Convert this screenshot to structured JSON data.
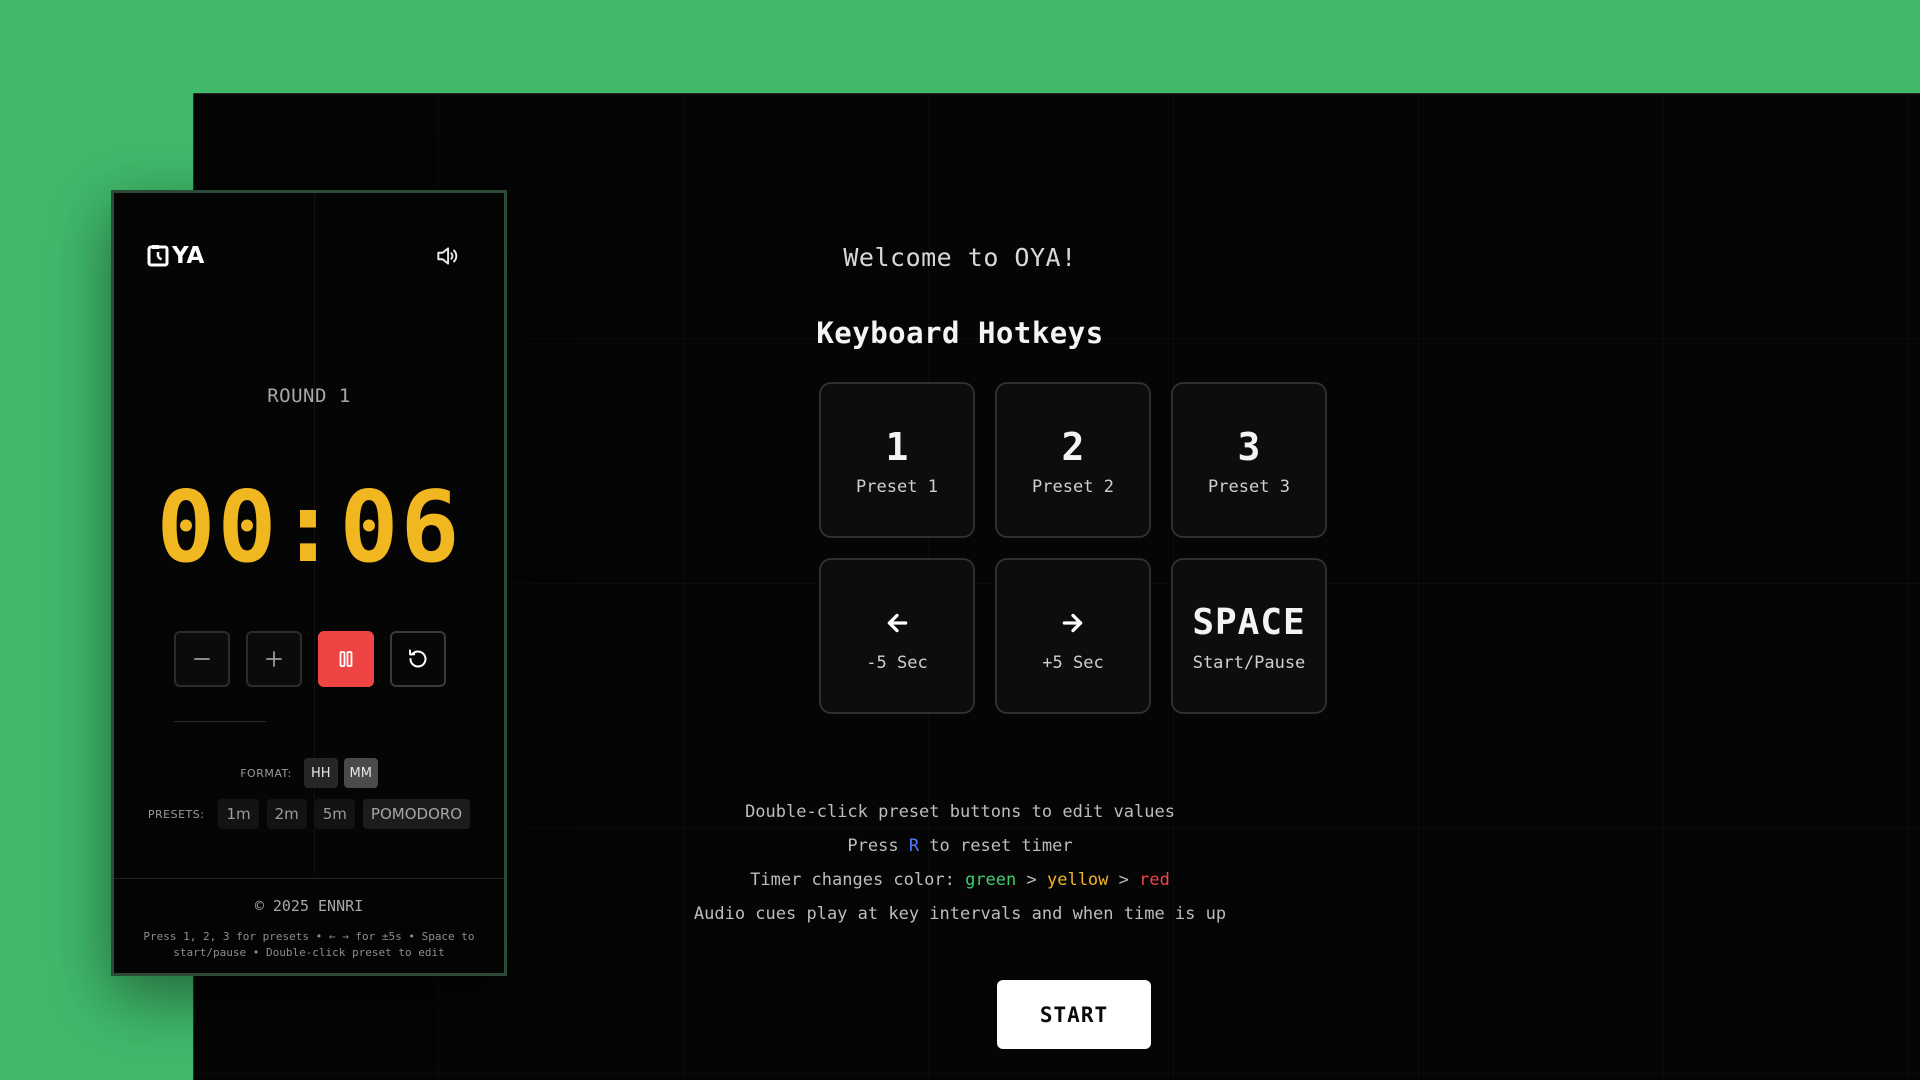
{
  "app": {
    "logo_text": "YA"
  },
  "main": {
    "welcome": "Welcome to OYA!",
    "hotkeys_title": "Keyboard Hotkeys",
    "hotkeys": [
      {
        "key": "1",
        "label": "Preset 1"
      },
      {
        "key": "2",
        "label": "Preset 2"
      },
      {
        "key": "3",
        "label": "Preset 3"
      },
      {
        "key": "arrow-left-icon",
        "label": "-5 Sec"
      },
      {
        "key": "arrow-right-icon",
        "label": "+5 Sec"
      },
      {
        "key": "SPACE",
        "label": "Start/Pause"
      }
    ],
    "tips": {
      "line1": "Double-click preset buttons to edit values",
      "line2_pre": "Press ",
      "line2_key": "R",
      "line2_post": " to reset timer",
      "line3_pre": "Timer changes color: ",
      "line3_green": "green",
      "line3_sep1": " > ",
      "line3_yellow": "yellow",
      "line3_sep2": " > ",
      "line3_red": "red",
      "line4": "Audio cues play at key intervals and when time is up"
    },
    "start_label": "START"
  },
  "widget": {
    "round": "ROUND 1",
    "time": "00:06",
    "format_label": "FORMAT:",
    "format_options": [
      "HH",
      "MM"
    ],
    "format_selected": "MM",
    "presets_label": "PRESETS:",
    "presets": [
      "1m",
      "2m",
      "5m",
      "POMODORO"
    ],
    "copyright": "© 2025 ENNRI",
    "hint": "Press 1, 2, 3 for presets • ← → for ±5s • Space to start/pause • Double-click preset to edit"
  },
  "colors": {
    "background": "#40b96b",
    "timer": "#f0b721",
    "pause": "#ef4444",
    "tip_blue": "#4f7cff",
    "tip_green": "#3ecf6e",
    "tip_yellow": "#f1b525",
    "tip_red": "#ef4545"
  }
}
